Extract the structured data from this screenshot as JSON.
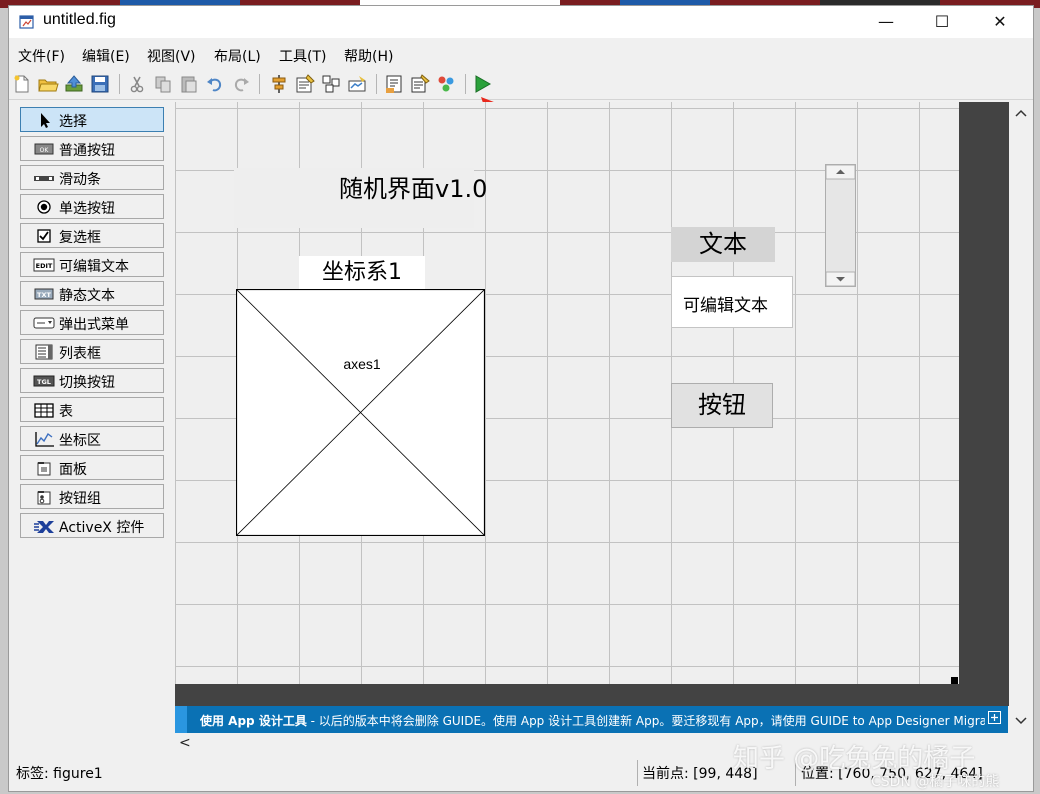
{
  "window": {
    "title": "untitled.fig",
    "controls": {
      "minimize": "—",
      "maximize": "☐",
      "close": "✕"
    }
  },
  "menubar": {
    "items": [
      "文件(F)",
      "编辑(E)",
      "视图(V)",
      "布局(L)",
      "工具(T)",
      "帮助(H)"
    ]
  },
  "toolbar": {
    "buttons": [
      "new-file-icon",
      "open-folder-icon",
      "save-to-workspace-icon",
      "save-icon",
      "cut-icon",
      "copy-icon",
      "paste-icon",
      "undo-icon",
      "redo-icon",
      "align-icon",
      "menu-editor-icon",
      "tab-order-icon",
      "toolbar-editor-icon",
      "editor-icon",
      "property-inspector-icon",
      "object-browser-icon",
      "run-icon"
    ]
  },
  "palette": {
    "items": [
      {
        "label": "选择",
        "icon": "pointer-icon",
        "selected": true
      },
      {
        "label": "普通按钮",
        "icon": "pushbutton-icon"
      },
      {
        "label": "滑动条",
        "icon": "slider-icon"
      },
      {
        "label": "单选按钮",
        "icon": "radiobutton-icon"
      },
      {
        "label": "复选框",
        "icon": "checkbox-icon"
      },
      {
        "label": "可编辑文本",
        "icon": "edit-text-icon"
      },
      {
        "label": "静态文本",
        "icon": "static-text-icon"
      },
      {
        "label": "弹出式菜单",
        "icon": "popup-menu-icon"
      },
      {
        "label": "列表框",
        "icon": "listbox-icon"
      },
      {
        "label": "切换按钮",
        "icon": "toggle-button-icon"
      },
      {
        "label": "表",
        "icon": "table-icon"
      },
      {
        "label": "坐标区",
        "icon": "axes-icon"
      },
      {
        "label": "面板",
        "icon": "panel-icon"
      },
      {
        "label": "按钮组",
        "icon": "button-group-icon"
      },
      {
        "label": "ActiveX 控件",
        "icon": "activex-icon"
      }
    ]
  },
  "canvas": {
    "title_text": "随机界面v1.0",
    "axes_label": "坐标系1",
    "axes_name": "axes1",
    "text_label": "文本",
    "edit_text": "可编辑文本",
    "button_label": "按钮"
  },
  "guide_banner": {
    "bold": "使用 App 设计工具",
    "text": " - 以后的版本中将会删除 GUIDE。使用 App 设计工具创建新 App。要迁移现有 App，请使用 GUIDE to App Designer Migration..."
  },
  "statusbar": {
    "tag": "标签: figure1",
    "current_point": "当前点:  [99, 448]",
    "position": "位置: [760, 750, 627, 464]"
  },
  "watermark": {
    "zhihu": "知乎 @吃兔兔的橘子",
    "csdn": "CSDN @橘子味的熊"
  },
  "colors": {
    "selected_palette": "#cce4f7",
    "guide_banner": "#0a71b4",
    "run_icon": "#2ba13b",
    "annotation_arrow": "#e8281c"
  }
}
